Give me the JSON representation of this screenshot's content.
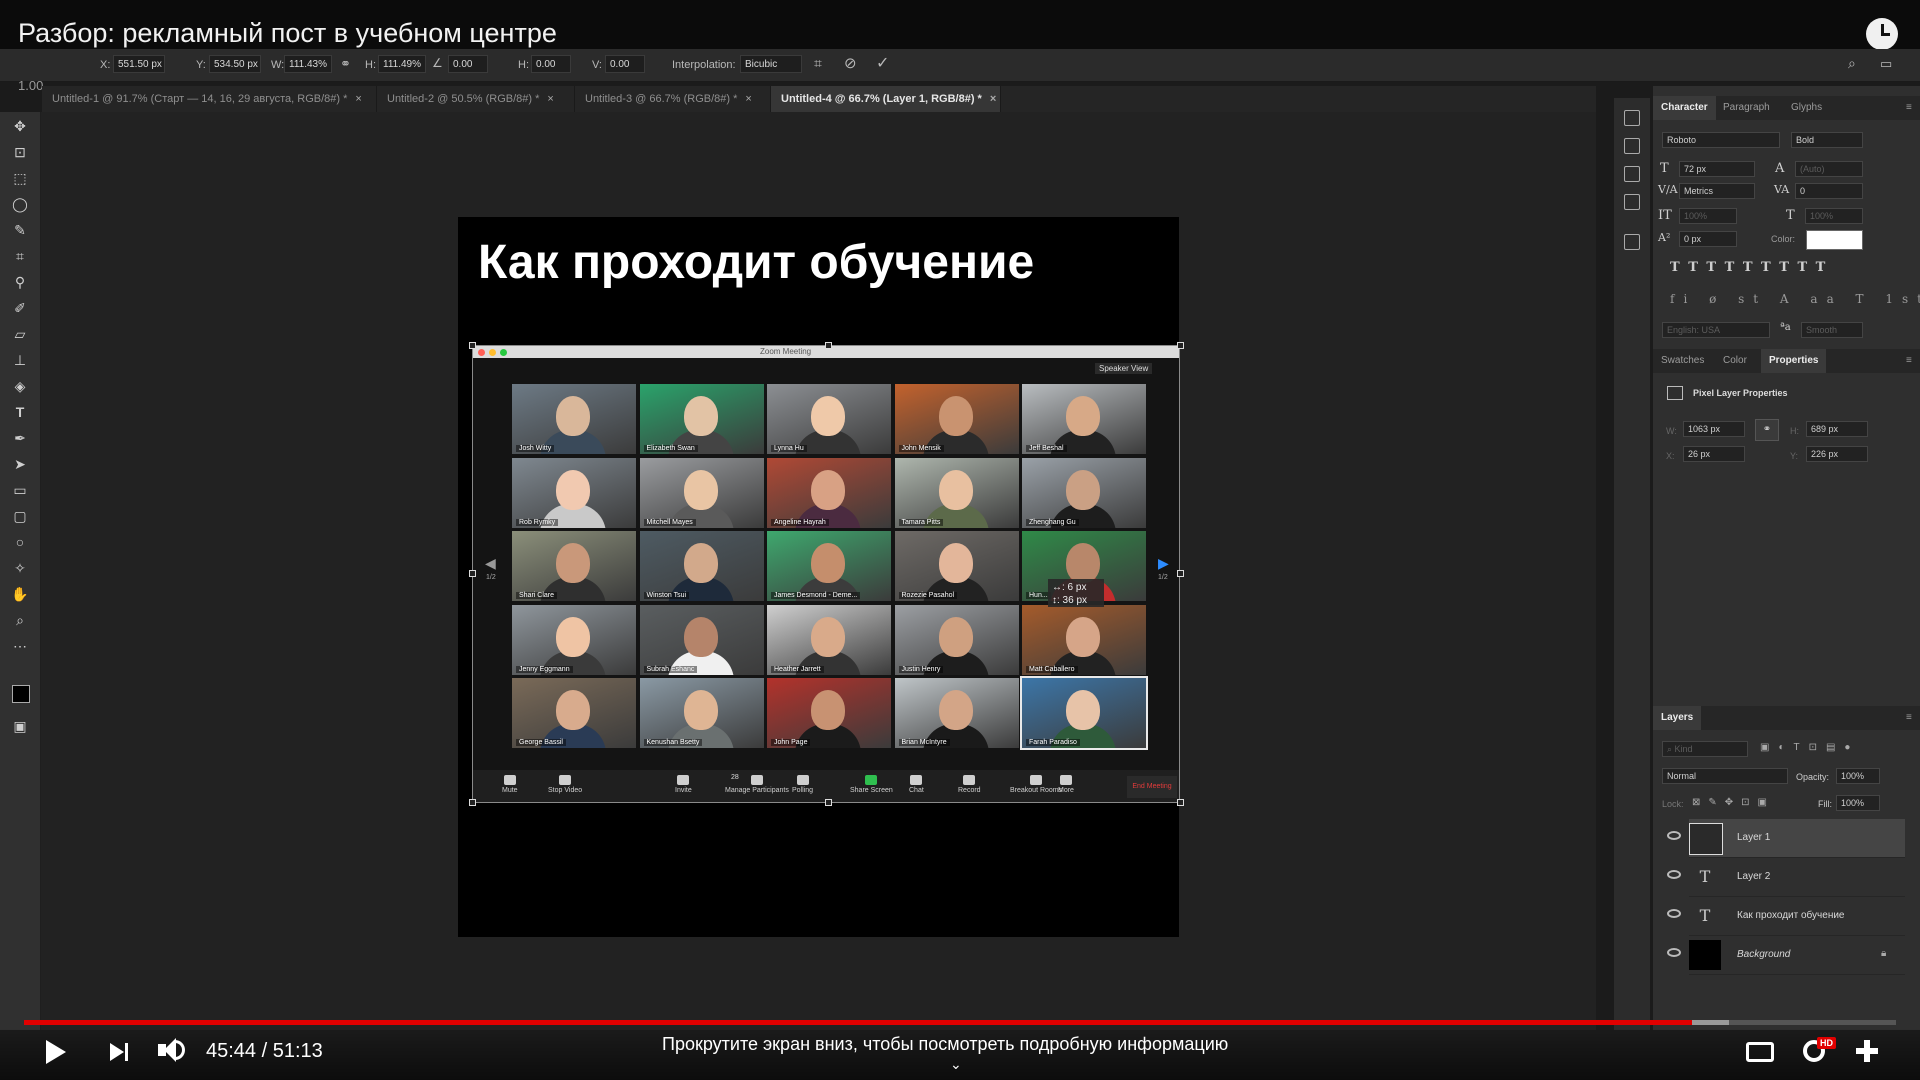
{
  "video": {
    "title": "Разбор: рекламный пост в учебном центре",
    "time": "45:44 / 51:13",
    "progress_fraction": 0.891,
    "buffer_fraction": 0.911,
    "scroll_hint": "Прокрутите экран вниз, чтобы посмотреть подробную информацию",
    "hd_badge": "HD"
  },
  "options_bar": {
    "x_label": "X:",
    "x_value": "551.50 px",
    "y_label": "Y:",
    "y_value": "534.50 px",
    "w_label": "W:",
    "w_value": "111.43%",
    "h_label": "H:",
    "h_value": "111.49%",
    "angle_value": "0.00",
    "hskew_label": "H:",
    "hskew_value": "0.00",
    "vskew_label": "V:",
    "vskew_value": "0.00",
    "interp_label": "Interpolation:",
    "interp_value": "Bicubic",
    "zoom_float": "1.00"
  },
  "tabs": [
    {
      "label": "Untitled-1 @ 91.7% (Старт — 14, 16, 29 августа, RGB/8#) *"
    },
    {
      "label": "Untitled-2 @ 50.5% (RGB/8#) *"
    },
    {
      "label": "Untitled-3 @ 66.7% (RGB/8#) *"
    },
    {
      "label": "Untitled-4 @ 66.7% (Layer 1, RGB/8#) *"
    }
  ],
  "document": {
    "heading": "Как проходит обучение",
    "zoom_window_title": "Zoom Meeting",
    "speaker_view": "Speaker View",
    "measure_line1": "↔: 6 px",
    "measure_line2": "↕: 36 px",
    "page_left": "1/2",
    "page_right": "1/2",
    "participants": [
      "Josh Witty",
      "Elizabeth Swan",
      "Lynna Hu",
      "John Mensik",
      "Jeff Beshal",
      "Rob Rymky",
      "Mitchell Mayes",
      "Angeline Hayrah",
      "Tamara Pitts",
      "Zhenghang Gu",
      "Shari Clare",
      "Winston Tsui",
      "James Desmond - Deme...",
      "Rozezie Pasahol",
      "Hun...",
      "Jenny Eggmann",
      "Subrah Eshanc",
      "Heather Jarrett",
      "Justin Henry",
      "Matt Caballero",
      "George Bassil",
      "Kenushan Bsetty",
      "John Page",
      "Brian McIntyre",
      "Farah Paradiso"
    ],
    "controls": [
      "Mute",
      "Stop Video",
      "Invite",
      "Manage Participants",
      "Polling",
      "Share Screen",
      "Chat",
      "Record",
      "Breakout Rooms",
      "More"
    ],
    "participant_count": "28",
    "end_meeting": "End Meeting"
  },
  "character_panel": {
    "tabs": [
      "Character",
      "Paragraph",
      "Glyphs"
    ],
    "font_family": "Roboto",
    "font_style": "Bold",
    "font_size": "72 px",
    "leading": "(Auto)",
    "kerning": "Metrics",
    "tracking": "0",
    "vscale": "100%",
    "hscale": "100%",
    "baseline": "0 px",
    "color_label": "Color:",
    "language": "English: USA",
    "antialias": "Smooth",
    "color_hex": "#ffffff"
  },
  "properties_panel": {
    "tabs": [
      "Swatches",
      "Color",
      "Properties"
    ],
    "title": "Pixel Layer Properties",
    "w_label": "W:",
    "w": "1063 px",
    "h_label": "H:",
    "h": "689 px",
    "x_label": "X:",
    "x": "26 px",
    "y_label": "Y:",
    "y": "226 px"
  },
  "layers_panel": {
    "tab": "Layers",
    "kind": "Kind",
    "blend_mode": "Normal",
    "opacity_label": "Opacity:",
    "opacity": "100%",
    "lock_label": "Lock:",
    "fill_label": "Fill:",
    "fill": "100%",
    "layers": [
      {
        "name": "Layer 1"
      },
      {
        "name": "Layer 2"
      },
      {
        "name": "Как проходит обучение"
      },
      {
        "name": "Background"
      }
    ]
  }
}
